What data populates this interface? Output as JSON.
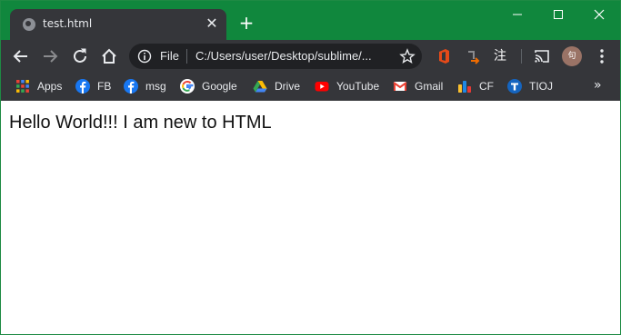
{
  "tab": {
    "title": "test.html",
    "close_glyph": "✕"
  },
  "new_tab_glyph": "+",
  "window_controls": [
    "minimize-icon",
    "maximize-icon",
    "close-icon"
  ],
  "toolbar": {
    "omnibox": {
      "scheme": "File",
      "url": "C:/Users/user/Desktop/sublime/..."
    },
    "icons": [
      "back-icon",
      "forward-icon",
      "reload-icon",
      "home-icon",
      "bookmark-star-icon",
      "office-extension-icon",
      "extension-arrow-icon",
      "dictionary-extension-icon",
      "cast-icon",
      "profile-avatar",
      "menu-icon"
    ],
    "dict_ext_glyph": "注",
    "avatar_glyph": "句"
  },
  "bookmarks": [
    {
      "label": "Apps",
      "icon": "apps-grid-icon"
    },
    {
      "label": "FB",
      "icon": "facebook-icon"
    },
    {
      "label": "msg",
      "icon": "facebook-icon"
    },
    {
      "label": "Google",
      "icon": "google-icon"
    },
    {
      "label": "Drive",
      "icon": "drive-icon"
    },
    {
      "label": "YouTube",
      "icon": "youtube-icon"
    },
    {
      "label": "Gmail",
      "icon": "gmail-icon"
    },
    {
      "label": "CF",
      "icon": "codeforces-icon"
    },
    {
      "label": "TIOJ",
      "icon": "tioj-icon"
    }
  ],
  "bookmarks_overflow": "»",
  "page": {
    "text": "Hello World!!! I am new to HTML"
  },
  "colors": {
    "titlebar": "#10873d",
    "toolbar": "#35363a",
    "omnibox": "#202124",
    "text": "#e8eaed"
  }
}
